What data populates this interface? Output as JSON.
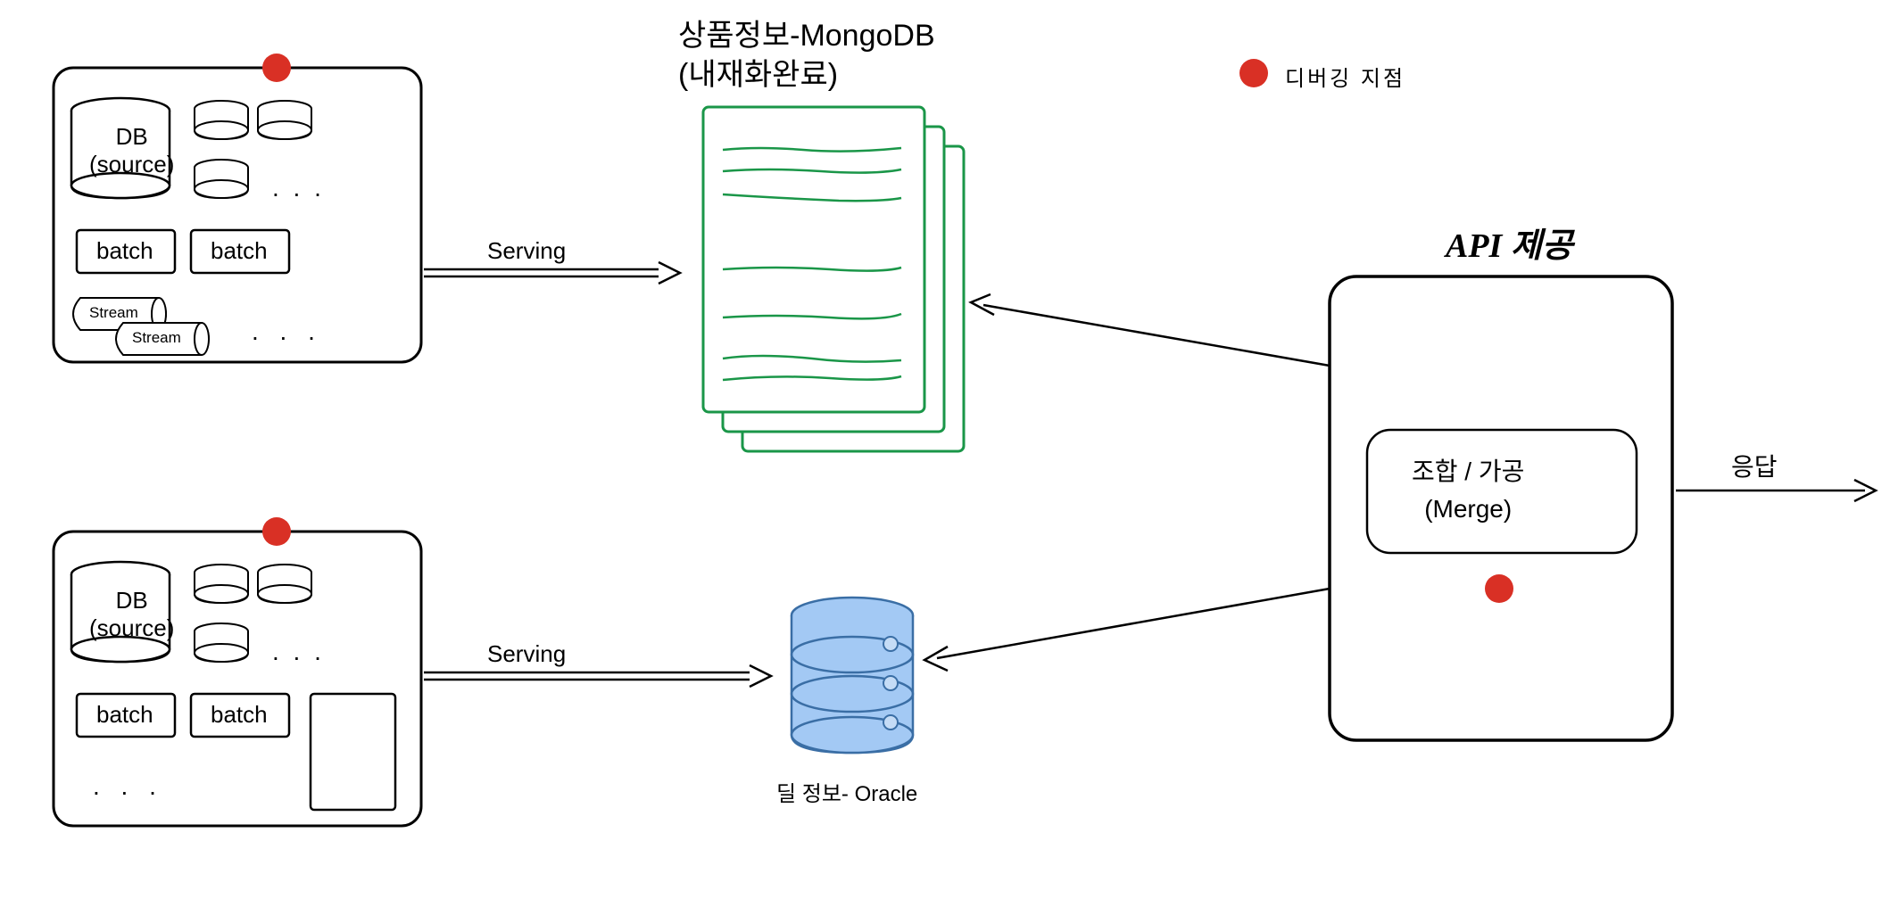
{
  "legend": {
    "label": "디버깅 지점"
  },
  "source_box_1": {
    "db_label": "DB\n(source)",
    "batch1": "batch",
    "batch2": "batch",
    "stream1": "Stream",
    "stream2": "Stream",
    "dots": ". . .",
    "dots2": ". . ."
  },
  "source_box_2": {
    "db_label": "DB\n(source)",
    "batch1": "batch",
    "batch2": "batch",
    "dots": ". . .",
    "dots2": ". . ."
  },
  "arrow_labels": {
    "serving1": "Serving",
    "serving2": "Serving",
    "response": "응답"
  },
  "mongodb": {
    "title": "상품정보-MongoDB",
    "subtitle": "(내재화완료)"
  },
  "oracle": {
    "title": "딜 정보- Oracle"
  },
  "api_box": {
    "title": "API 제공",
    "merge_label1": "조합 / 가공",
    "merge_label2": "(Merge)"
  }
}
